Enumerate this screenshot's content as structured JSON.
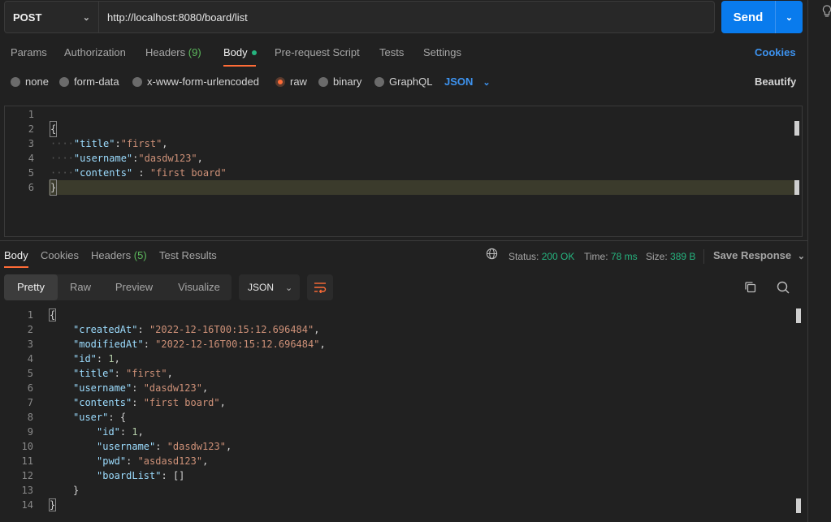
{
  "request": {
    "method": "POST",
    "url": "http://localhost:8080/board/list",
    "send_label": "Send"
  },
  "request_tabs": [
    {
      "label": "Params"
    },
    {
      "label": "Authorization"
    },
    {
      "label": "Headers",
      "count": "(9)"
    },
    {
      "label": "Body"
    },
    {
      "label": "Pre-request Script"
    },
    {
      "label": "Tests"
    },
    {
      "label": "Settings"
    }
  ],
  "cookies_link": "Cookies",
  "body_types": [
    "none",
    "form-data",
    "x-www-form-urlencoded",
    "raw",
    "binary",
    "GraphQL"
  ],
  "body_language": "JSON",
  "beautify_label": "Beautify",
  "request_body_lines": [
    {
      "n": "1"
    },
    {
      "n": "2"
    },
    {
      "n": "3",
      "key": "\"title\"",
      "sep": ":",
      "val": "\"first\"",
      "end": ","
    },
    {
      "n": "4",
      "key": "\"username\"",
      "sep": ":",
      "val": "\"dasdw123\"",
      "end": ","
    },
    {
      "n": "5",
      "key": "\"contents\"",
      "sep": " : ",
      "val": "\"first board\"",
      "end": ""
    },
    {
      "n": "6"
    }
  ],
  "response_tabs": [
    {
      "label": "Body"
    },
    {
      "label": "Cookies"
    },
    {
      "label": "Headers",
      "count": "(5)"
    },
    {
      "label": "Test Results"
    }
  ],
  "status": {
    "status_label": "Status:",
    "status_value": "200 OK",
    "time_label": "Time:",
    "time_value": "78 ms",
    "size_label": "Size:",
    "size_value": "389 B",
    "save_response": "Save Response"
  },
  "view_modes": [
    "Pretty",
    "Raw",
    "Preview",
    "Visualize"
  ],
  "response_format": "JSON",
  "response_lines": [
    {
      "n": "1",
      "text": "{"
    },
    {
      "n": "2",
      "indent": 1,
      "key": "\"createdAt\"",
      "val": "\"2022-12-16T00:15:12.696484\"",
      "end": ","
    },
    {
      "n": "3",
      "indent": 1,
      "key": "\"modifiedAt\"",
      "val": "\"2022-12-16T00:15:12.696484\"",
      "end": ","
    },
    {
      "n": "4",
      "indent": 1,
      "key": "\"id\"",
      "num": "1",
      "end": ","
    },
    {
      "n": "5",
      "indent": 1,
      "key": "\"title\"",
      "val": "\"first\"",
      "end": ","
    },
    {
      "n": "6",
      "indent": 1,
      "key": "\"username\"",
      "val": "\"dasdw123\"",
      "end": ","
    },
    {
      "n": "7",
      "indent": 1,
      "key": "\"contents\"",
      "val": "\"first board\"",
      "end": ","
    },
    {
      "n": "8",
      "indent": 1,
      "key": "\"user\"",
      "raw": "{"
    },
    {
      "n": "9",
      "indent": 2,
      "key": "\"id\"",
      "num": "1",
      "end": ","
    },
    {
      "n": "10",
      "indent": 2,
      "key": "\"username\"",
      "val": "\"dasdw123\"",
      "end": ","
    },
    {
      "n": "11",
      "indent": 2,
      "key": "\"pwd\"",
      "val": "\"asdasd123\"",
      "end": ","
    },
    {
      "n": "12",
      "indent": 2,
      "key": "\"boardList\"",
      "raw": "[]"
    },
    {
      "n": "13",
      "indent": 1,
      "text": "}"
    },
    {
      "n": "14",
      "text": "}"
    }
  ],
  "icons": {
    "method_chevron": "chevron-down-icon",
    "send_chevron": "chevron-down-icon",
    "globe": "globe-icon",
    "wrap": "wrap-lines-icon",
    "copy": "copy-icon",
    "search": "search-icon",
    "bulb": "lightbulb-icon"
  },
  "colors": {
    "accent": "#ff6c37",
    "send": "#097bed",
    "link": "#3d93f0",
    "ok": "#26b47f"
  }
}
